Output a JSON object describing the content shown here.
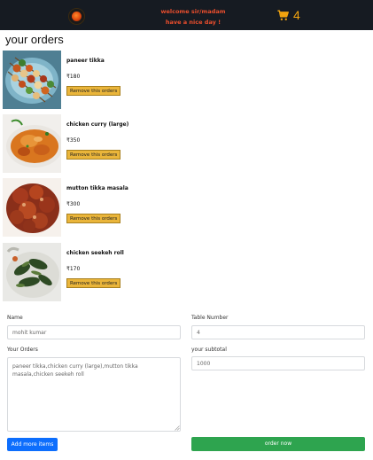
{
  "header": {
    "welcome_line1": "welcome sir/madam",
    "welcome_line2": "have a nice day !",
    "cart_count": "4",
    "cart_icon": "cart-icon",
    "logo_icon": "restaurant-logo"
  },
  "page_title": "your orders",
  "orders": [
    {
      "name": "paneer tikka",
      "price": "₹180",
      "remove_label": "Remove this orders"
    },
    {
      "name": "chicken curry (large)",
      "price": "₹350",
      "remove_label": "Remove this orders"
    },
    {
      "name": "mutton tikka masala",
      "price": "₹300",
      "remove_label": "Remove this orders"
    },
    {
      "name": "chicken seekeh roll",
      "price": "₹170",
      "remove_label": "Remove this orders"
    }
  ],
  "form": {
    "name_label": "Name",
    "name_value": "mohit kumar",
    "table_label": "Table Number",
    "table_value": "4",
    "orders_label": "Your Orders",
    "orders_value": "paneer tikka,chicken curry (large),mutton tikka masala,chicken seekeh roll",
    "subtotal_label": "your subtotal",
    "subtotal_value": "1000",
    "add_more_label": "Add more items",
    "order_now_label": "order now"
  },
  "colors": {
    "navbar": "#161b22",
    "welcome_text": "#ea4e2d",
    "cart": "#f2a40f",
    "remove_button": "#eab53a",
    "add_button": "#0d6efd",
    "order_button": "#2ea44f"
  }
}
